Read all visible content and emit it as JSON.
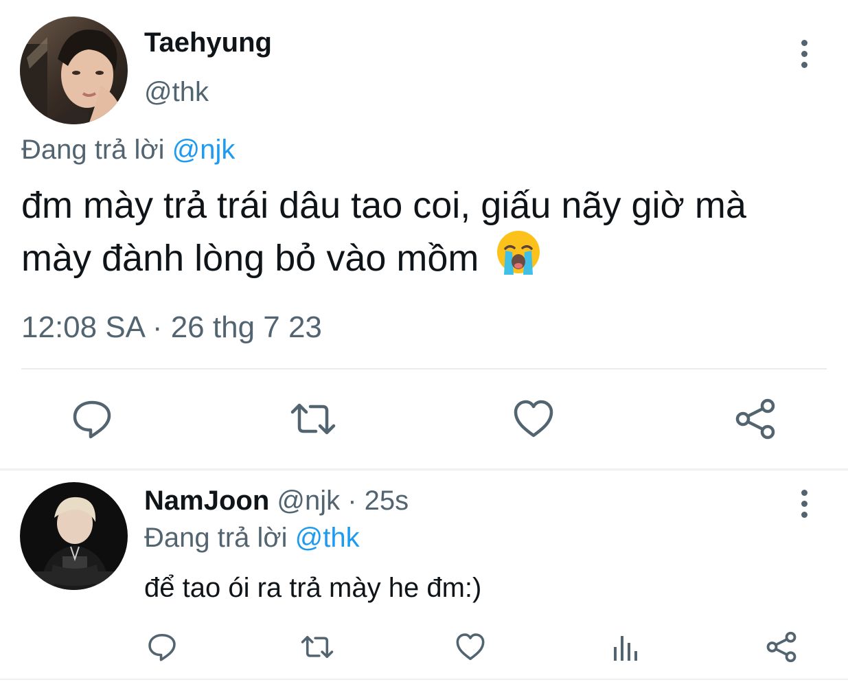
{
  "main_tweet": {
    "author_name": "Taehyung",
    "handle": "@thk",
    "replying_prefix": "Đang trả lời",
    "replying_to": "@njk",
    "text_line1": "đm mày trả trái dâu tao coi, giấu nãy giờ mà",
    "text_line2": "mày đành lòng bỏ vào mồm",
    "emoji": "😭",
    "timestamp": "12:08 SA · 26 thg 7 23",
    "actions": [
      "reply-icon",
      "retweet-icon",
      "like-icon",
      "share-icon"
    ]
  },
  "reply_tweet": {
    "author_name": "NamJoon",
    "handle": "@njk",
    "time_ago": "· 25s",
    "replying_prefix": "Đang trả lời",
    "replying_to": "@thk",
    "text": "để tao ói ra trả mày he đm:)",
    "actions": [
      "reply-icon",
      "retweet-icon",
      "like-icon",
      "analytics-icon",
      "share-icon"
    ]
  },
  "colors": {
    "text": "#0f1419",
    "muted": "#536471",
    "link": "#1d9bf0",
    "divider": "#e6ecf0"
  }
}
